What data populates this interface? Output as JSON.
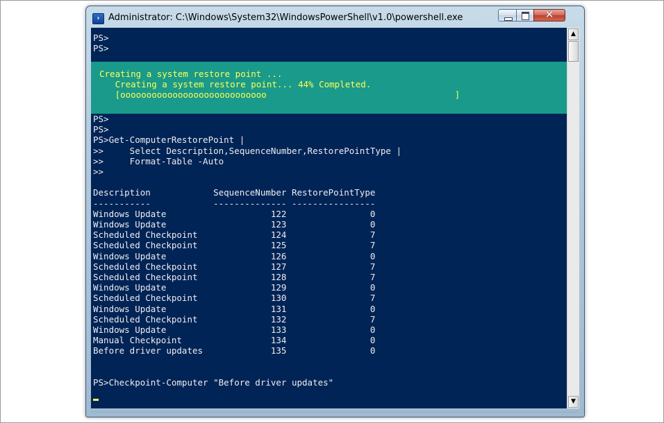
{
  "window": {
    "title": "Administrator: C:\\Windows\\System32\\WindowsPowerShell\\v1.0\\powershell.exe",
    "icon": "powershell-icon",
    "close_glyph": "✕",
    "colors": {
      "console_bg": "#012456",
      "console_fg": "#eeedf0",
      "progress_bg": "#1a9a8a",
      "progress_fg": "#ffff55"
    }
  },
  "console": {
    "lines_top": "PS>\nPS>",
    "progress": {
      "activity": "Creating a system restore point ...",
      "status": "Creating a system restore point... 44% Completed.",
      "bar": "[oooooooooooooooooooooooooooo                                    ]",
      "percent": 44
    },
    "lines_main": "PS>\nPS>\nPS>Get-ComputerRestorePoint |\n>>     Select Description,SequenceNumber,RestorePointType |\n>>     Format-Table -Auto\n>>\n\nDescription            SequenceNumber RestorePointType\n-----------            -------------- ----------------\nWindows Update                    122                0\nWindows Update                    123                0\nScheduled Checkpoint              124                7\nScheduled Checkpoint              125                7\nWindows Update                    126                0\nScheduled Checkpoint              127                7\nScheduled Checkpoint              128                7\nWindows Update                    129                0\nScheduled Checkpoint              130                7\nWindows Update                    131                0\nScheduled Checkpoint              132                7\nWindows Update                    133                0\nManual Checkpoint                 134                0\nBefore driver updates             135                0\n\n\nPS>Checkpoint-Computer \"Before driver updates\""
  },
  "scrollbar": {
    "up_arrow": "▲",
    "down_arrow": "▼"
  }
}
